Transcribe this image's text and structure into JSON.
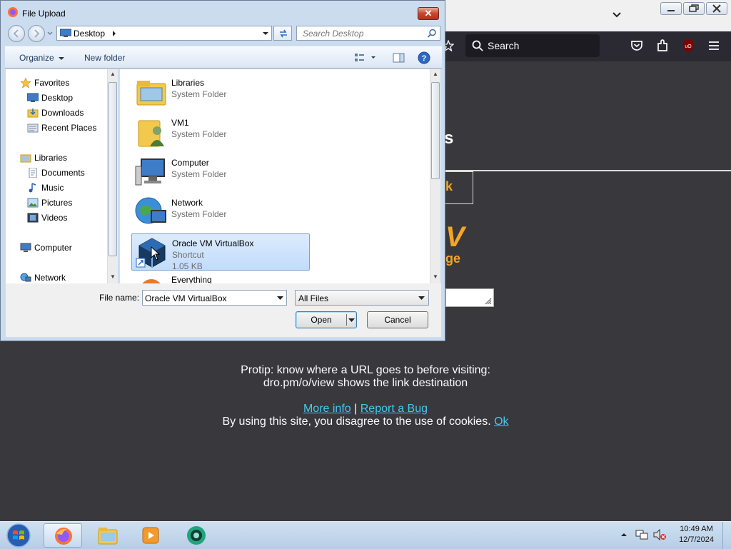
{
  "firefox": {
    "search_placeholder": "Search",
    "bg_heading_fragment": "s",
    "bg_box_fragment": "k",
    "bg_v_fragment": "V",
    "bg_ge_fragment": "ge",
    "protip_line1": "Protip: know where a URL goes to before visiting:",
    "protip_line2": "dro.pm/o/view shows the link destination",
    "link_more_info": "More info",
    "separator": "|",
    "link_report_bug": "Report a Bug",
    "cookie_text": "By using this site, you disagree to the use of cookies.",
    "link_ok": "Ok",
    "colors": {
      "accent_link": "#45c8f0",
      "accent_orange": "#f5a623",
      "bg": "#38383d"
    }
  },
  "dialog": {
    "title": "File Upload",
    "close_glyph": "✕",
    "address": {
      "location": "Desktop"
    },
    "search_placeholder": "Search Desktop",
    "command_bar": {
      "organize": "Organize",
      "new_folder": "New folder"
    },
    "nav_pane": {
      "favorites_label": "Favorites",
      "favorites": [
        {
          "label": "Desktop",
          "icon": "desktop-icon"
        },
        {
          "label": "Downloads",
          "icon": "downloads-icon"
        },
        {
          "label": "Recent Places",
          "icon": "recent-places-icon"
        }
      ],
      "libraries_label": "Libraries",
      "libraries": [
        {
          "label": "Documents",
          "icon": "documents-icon"
        },
        {
          "label": "Music",
          "icon": "music-icon"
        },
        {
          "label": "Pictures",
          "icon": "pictures-icon"
        },
        {
          "label": "Videos",
          "icon": "videos-icon"
        }
      ],
      "computer_label": "Computer",
      "network_label": "Network"
    },
    "files": [
      {
        "name": "Libraries",
        "type": "System Folder",
        "size": "",
        "icon": "libraries-folder-icon",
        "selected": false
      },
      {
        "name": "VM1",
        "type": "System Folder",
        "size": "",
        "icon": "user-folder-icon",
        "selected": false
      },
      {
        "name": "Computer",
        "type": "System Folder",
        "size": "",
        "icon": "computer-icon",
        "selected": false
      },
      {
        "name": "Network",
        "type": "System Folder",
        "size": "",
        "icon": "network-globe-icon",
        "selected": false
      },
      {
        "name": "Oracle VM VirtualBox",
        "type": "Shortcut",
        "size": "1.05 KB",
        "icon": "virtualbox-icon",
        "selected": true
      },
      {
        "name": "Everything",
        "type": "",
        "size": "",
        "icon": "everything-icon",
        "selected": false
      }
    ],
    "file_name_label": "File name:",
    "file_name_value": "Oracle VM VirtualBox",
    "file_type_value": "All Files",
    "open_button": "Open",
    "cancel_button": "Cancel"
  },
  "taskbar": {
    "clock_time": "10:49 AM",
    "clock_date": "12/7/2024",
    "items": [
      "firefox-icon",
      "explorer-icon",
      "media-player-icon",
      "app-icon"
    ]
  }
}
